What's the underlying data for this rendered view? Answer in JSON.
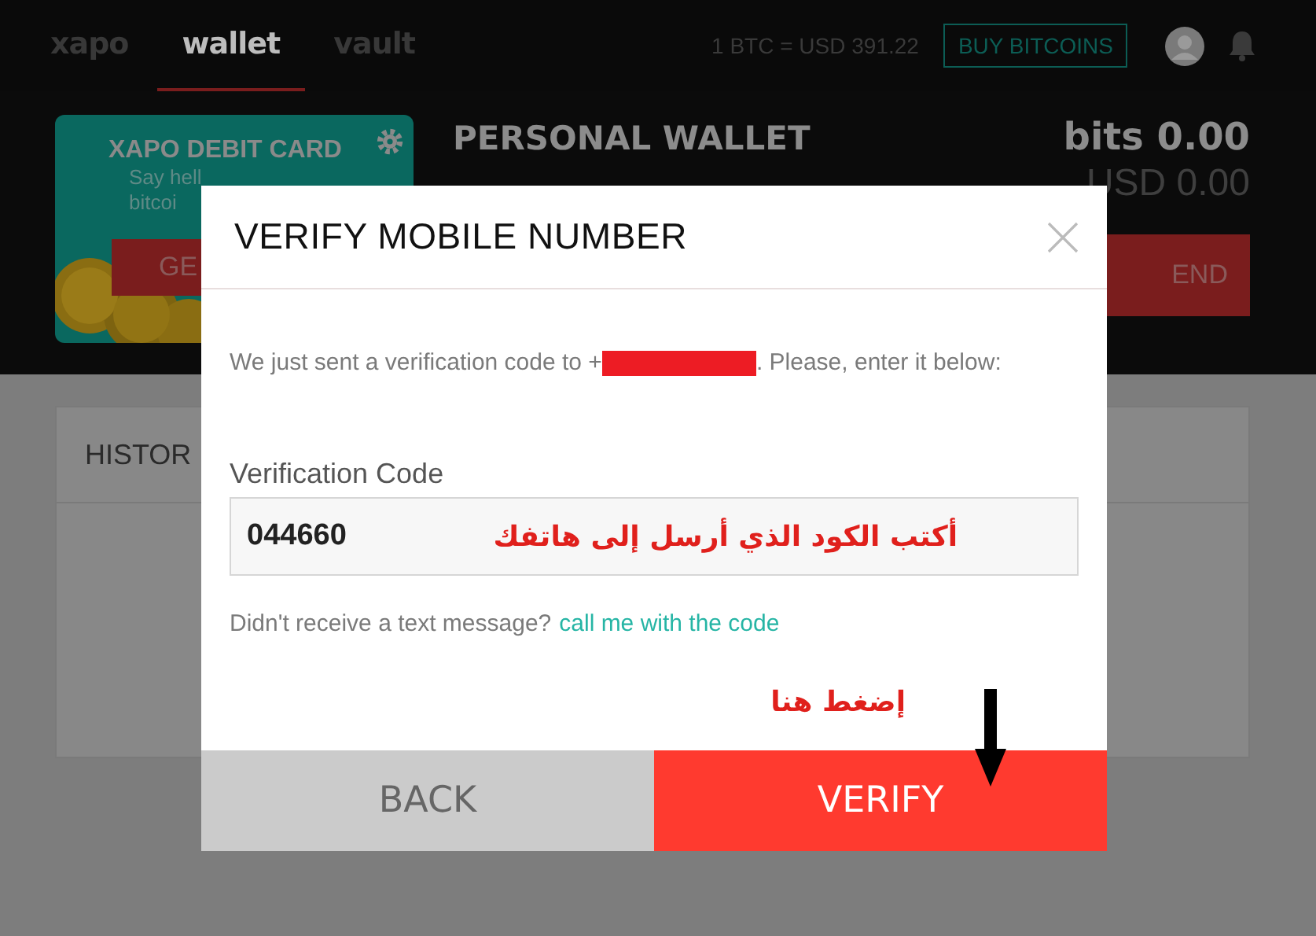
{
  "nav": {
    "tabs": [
      {
        "label": "xapo",
        "selected": false
      },
      {
        "label": "wallet",
        "selected": true
      },
      {
        "label": "vault",
        "selected": false
      }
    ],
    "rate": "1 BTC = USD 391.22",
    "buy_button": "BUY BITCOINS"
  },
  "debit_card": {
    "title": "XAPO DEBIT CARD",
    "text_lines": [
      "Say hell",
      "bitcoi"
    ],
    "button": "GE"
  },
  "wallet": {
    "title": "PERSONAL WALLET",
    "balance": "bits 0.00",
    "balance_usd": "USD 0.00",
    "send_button": "END"
  },
  "history": {
    "title": "HISTOR"
  },
  "dialog": {
    "title": "VERIFY MOBILE NUMBER",
    "message_start": "We just sent a verification code to +",
    "message_end": ". Please, enter it below:",
    "field_label": "Verification Code",
    "code_value": "044660",
    "field_note": "أكتب الكود الذي أرسل إلى هاتفك",
    "help_text": "Didn't receive a text message?",
    "help_link": "call me with the code",
    "arrow_note": "إضغط هنا",
    "buttons": [
      {
        "label": "BACK",
        "kind": "secondary"
      },
      {
        "label": "VERIFY",
        "kind": "primary"
      }
    ]
  }
}
